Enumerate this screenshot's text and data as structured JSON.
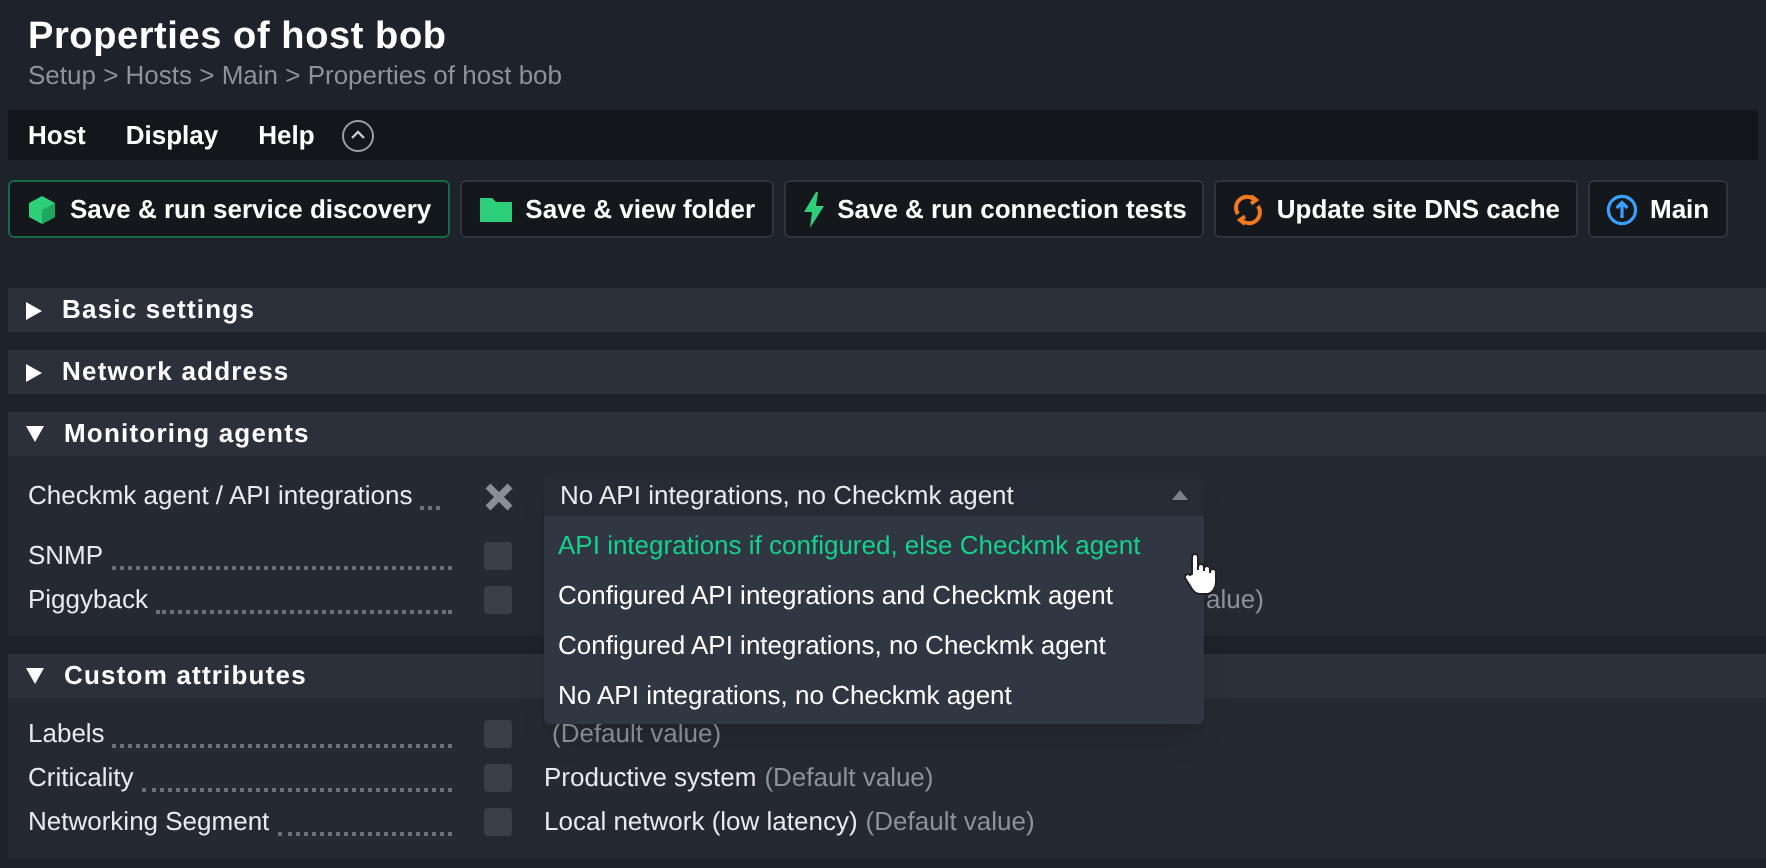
{
  "title": "Properties of host bob",
  "breadcrumb": "Setup > Hosts > Main > Properties of host bob",
  "menu": [
    {
      "label": "Host"
    },
    {
      "label": "Display"
    },
    {
      "label": "Help"
    }
  ],
  "buttons": [
    {
      "label": "Save & run service discovery",
      "kind": "cube",
      "primary": true
    },
    {
      "label": "Save & view folder",
      "kind": "folder",
      "primary": false
    },
    {
      "label": "Save & run connection tests",
      "kind": "bolt",
      "primary": false
    },
    {
      "label": "Update site DNS cache",
      "kind": "refresh",
      "primary": false
    },
    {
      "label": "Main",
      "kind": "up",
      "primary": false
    }
  ],
  "sections": [
    {
      "title": "Basic settings",
      "expanded": false
    },
    {
      "title": "Network address",
      "expanded": false
    },
    {
      "title": "Monitoring agents",
      "expanded": true,
      "rows": [
        {
          "label": "Checkmk agent / API integrations",
          "kind": "dropdown",
          "checked": true,
          "dropdown": {
            "value": "No API integrations, no Checkmk agent",
            "options": [
              {
                "label": "API integrations if configured, else Checkmk agent",
                "highlighted": true
              },
              {
                "label": "Configured API integrations and Checkmk agent",
                "highlighted": false
              },
              {
                "label": "Configured API integrations, no Checkmk agent",
                "highlighted": false
              },
              {
                "label": "No API integrations, no Checkmk agent",
                "highlighted": false
              }
            ]
          }
        },
        {
          "label": "SNMP",
          "kind": "covered",
          "checked": false
        },
        {
          "label": "Piggyback",
          "kind": "covered",
          "checked": false,
          "note": "alue)"
        }
      ]
    },
    {
      "title": "Custom attributes",
      "expanded": true,
      "rows": [
        {
          "label": "Labels",
          "kind": "text",
          "checked": false,
          "note": "(Default value)"
        },
        {
          "label": "Criticality",
          "kind": "text",
          "checked": false,
          "value": "Productive system",
          "note": "(Default value)"
        },
        {
          "label": "Networking Segment",
          "kind": "text",
          "checked": false,
          "value": "Local network (low latency)",
          "note": "(Default value)"
        }
      ]
    }
  ]
}
